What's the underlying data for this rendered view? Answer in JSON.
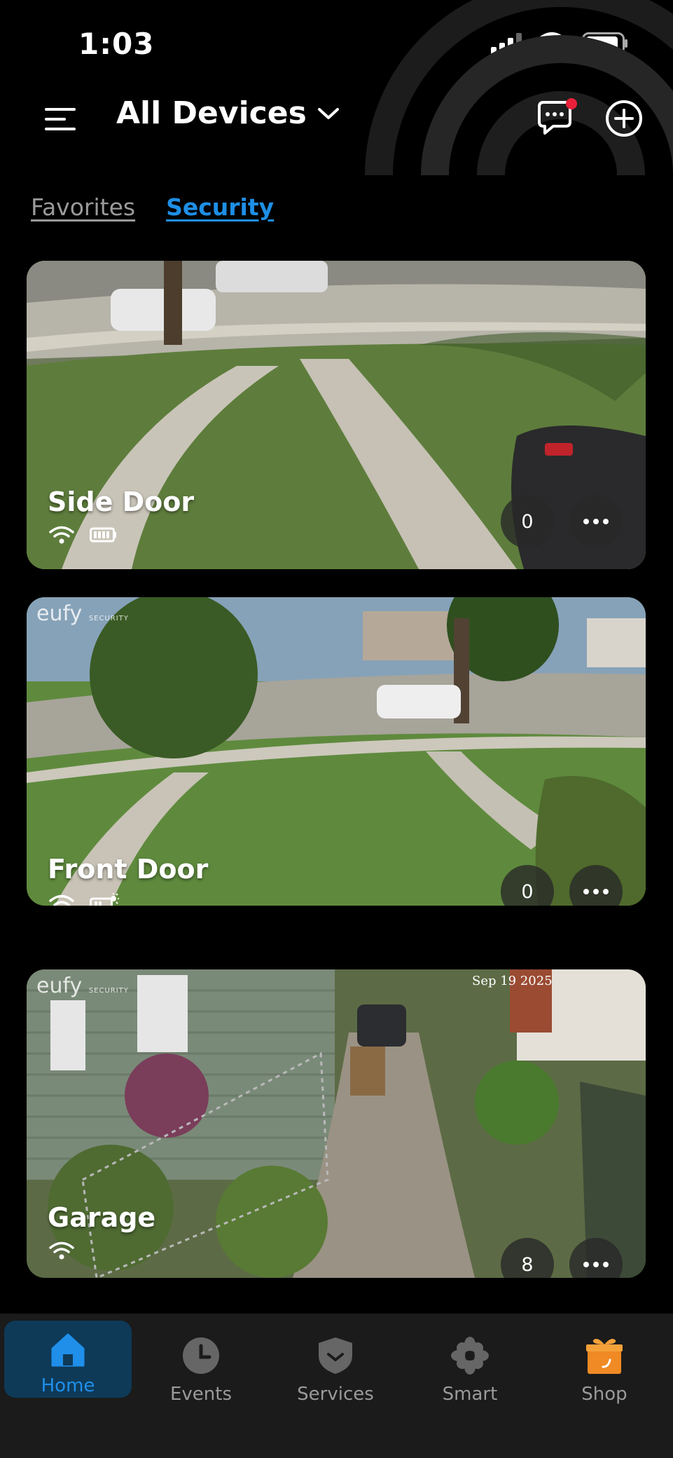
{
  "status_bar": {
    "time": "1:03"
  },
  "header": {
    "title": "All Devices"
  },
  "tabs": [
    {
      "label": "Favorites",
      "active": false
    },
    {
      "label": "Security",
      "active": true
    }
  ],
  "devices": [
    {
      "name": "Side Door",
      "event_count": "0",
      "connection": "wifi-icon",
      "power": "battery-icon"
    },
    {
      "name": "Front Door",
      "event_count": "0",
      "connection": "wifi-icon",
      "power": "solar-battery-icon",
      "brand": "eufy",
      "brand_sub": "SECURITY"
    },
    {
      "name": "Garage",
      "event_count": "8",
      "connection": "wifi-icon",
      "brand": "eufy",
      "brand_sub": "SECURITY",
      "timestamp": "Sep 19 2025"
    }
  ],
  "bottom_nav": [
    {
      "label": "Home",
      "active": true
    },
    {
      "label": "Events",
      "active": false
    },
    {
      "label": "Services",
      "active": false
    },
    {
      "label": "Smart",
      "active": false
    },
    {
      "label": "Shop",
      "active": false
    }
  ],
  "colors": {
    "accent": "#1e8fe6",
    "notification": "#e8203a",
    "nav_bg": "#1b1b1b",
    "shop": "#f08a24"
  }
}
